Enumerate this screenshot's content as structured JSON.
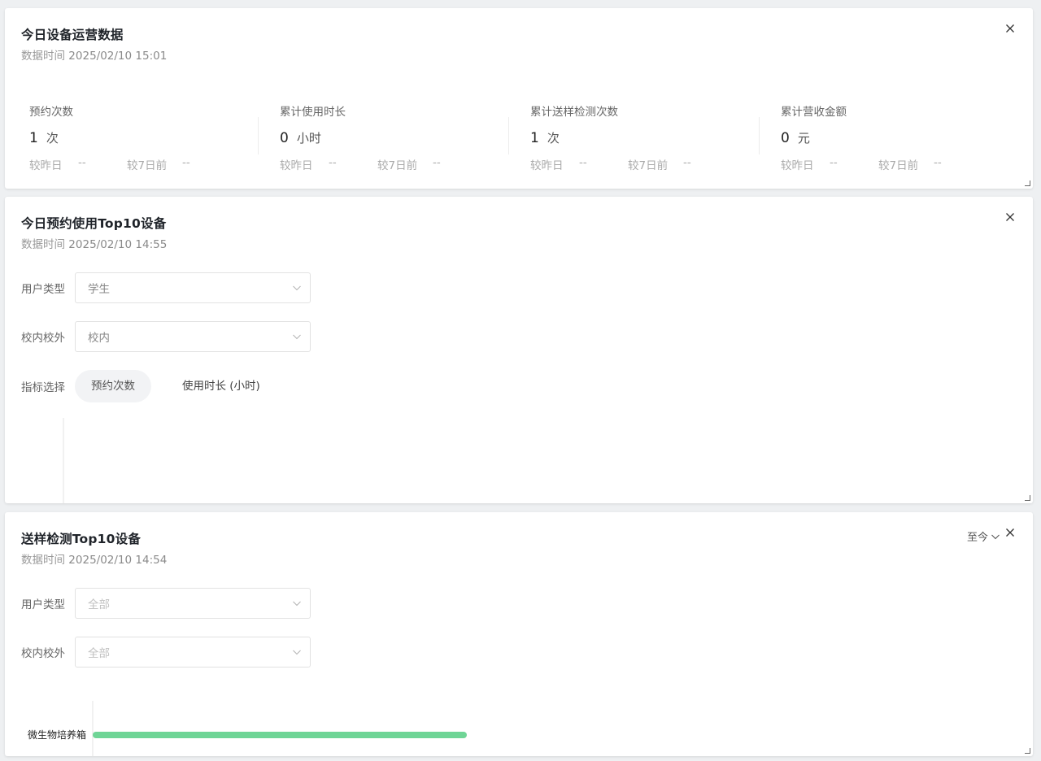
{
  "card1": {
    "title": "今日设备运营数据",
    "sub_label": "数据时间",
    "timestamp": "2025/02/10 15:01",
    "metrics": [
      {
        "label": "预约次数",
        "value": "1",
        "unit": "次",
        "cmp_day_label": "较昨日",
        "cmp_day": "--",
        "cmp_week_label": "较7日前",
        "cmp_week": "--"
      },
      {
        "label": "累计使用时长",
        "value": "0",
        "unit": "小时",
        "cmp_day_label": "较昨日",
        "cmp_day": "--",
        "cmp_week_label": "较7日前",
        "cmp_week": "--"
      },
      {
        "label": "累计送样检测次数",
        "value": "1",
        "unit": "次",
        "cmp_day_label": "较昨日",
        "cmp_day": "--",
        "cmp_week_label": "较7日前",
        "cmp_week": "--"
      },
      {
        "label": "累计营收金额",
        "value": "0",
        "unit": "元",
        "cmp_day_label": "较昨日",
        "cmp_day": "--",
        "cmp_week_label": "较7日前",
        "cmp_week": "--"
      }
    ]
  },
  "card2": {
    "title": "今日预约使用Top10设备",
    "sub_label": "数据时间",
    "timestamp": "2025/02/10 14:55",
    "user_type_label": "用户类型",
    "user_type_value": "学生",
    "campus_label": "校内校外",
    "campus_value": "校内",
    "metric_label": "指标选择",
    "metric_options": [
      "预约次数",
      "使用时长 (小时)"
    ],
    "metric_selected": "预约次数"
  },
  "card3": {
    "title": "送样检测Top10设备",
    "sub_label": "数据时间",
    "timestamp": "2025/02/10 14:54",
    "range_label": "至今",
    "user_type_label": "用户类型",
    "user_type_placeholder": "全部",
    "campus_label": "校内校外",
    "campus_placeholder": "全部"
  },
  "colors": {
    "bar": "#6fd596",
    "accent_text": "#1f2329"
  },
  "icons": [
    "close-icon",
    "chevron-down-icon",
    "resize-handle-icon"
  ],
  "chart_data": [
    {
      "type": "bar",
      "orientation": "horizontal",
      "categories": [],
      "values": []
    },
    {
      "type": "bar",
      "orientation": "horizontal",
      "categories": [
        "微生物培养箱"
      ],
      "values": [
        1
      ]
    }
  ]
}
